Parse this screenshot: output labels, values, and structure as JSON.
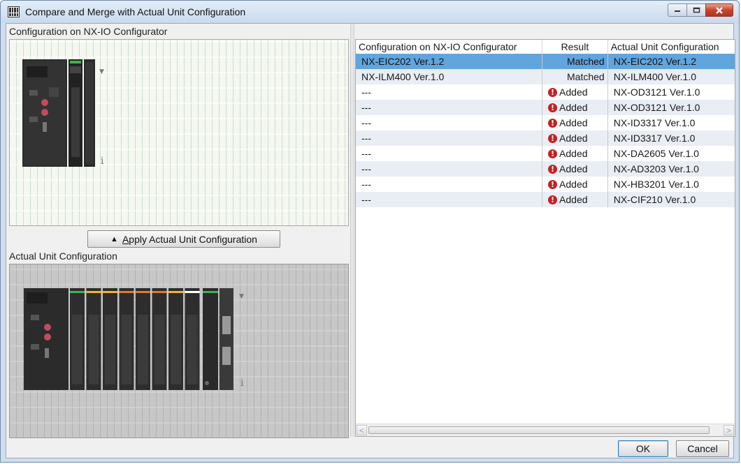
{
  "window": {
    "title": "Compare and Merge with Actual Unit Configuration",
    "icon": "grid-app-icon",
    "controls": [
      "minimize-icon",
      "maximize-icon",
      "close-icon"
    ]
  },
  "left_panel": {
    "top_label": "Configuration on NX-IO Configurator",
    "apply_button_arrow": "▲",
    "apply_button_accel": "A",
    "apply_button_rest": "pply Actual Unit Configuration",
    "bottom_label": "Actual Unit Configuration",
    "info_glyph": "i",
    "dropdown_glyph": "▼"
  },
  "table": {
    "columns": [
      "Configuration on NX-IO Configurator",
      "Result",
      "Actual Unit Configuration"
    ],
    "rows": [
      {
        "config": "NX-EIC202 Ver.1.2",
        "result": "Matched",
        "actual": "NX-EIC202 Ver.1.2",
        "selected": true
      },
      {
        "config": "NX-ILM400 Ver.1.0",
        "result": "Matched",
        "actual": "NX-ILM400 Ver.1.0"
      },
      {
        "config": "---",
        "result": "Added",
        "actual": "NX-OD3121 Ver.1.0"
      },
      {
        "config": "---",
        "result": "Added",
        "actual": "NX-OD3121 Ver.1.0"
      },
      {
        "config": "---",
        "result": "Added",
        "actual": "NX-ID3317 Ver.1.0"
      },
      {
        "config": "---",
        "result": "Added",
        "actual": "NX-ID3317 Ver.1.0"
      },
      {
        "config": "---",
        "result": "Added",
        "actual": "NX-DA2605 Ver.1.0"
      },
      {
        "config": "---",
        "result": "Added",
        "actual": "NX-AD3203 Ver.1.0"
      },
      {
        "config": "---",
        "result": "Added",
        "actual": "NX-HB3201 Ver.1.0"
      },
      {
        "config": "---",
        "result": "Added",
        "actual": "NX-CIF210 Ver.1.0"
      }
    ],
    "warn_glyph": "!",
    "scroll_left": "<",
    "scroll_right": ">"
  },
  "buttons": {
    "ok": "OK",
    "cancel": "Cancel"
  },
  "colors": {
    "selected_row": "#61a5de",
    "warning": "#c62020",
    "matched_green": "#3fb34f",
    "unit_body": "#2b2b2b"
  }
}
